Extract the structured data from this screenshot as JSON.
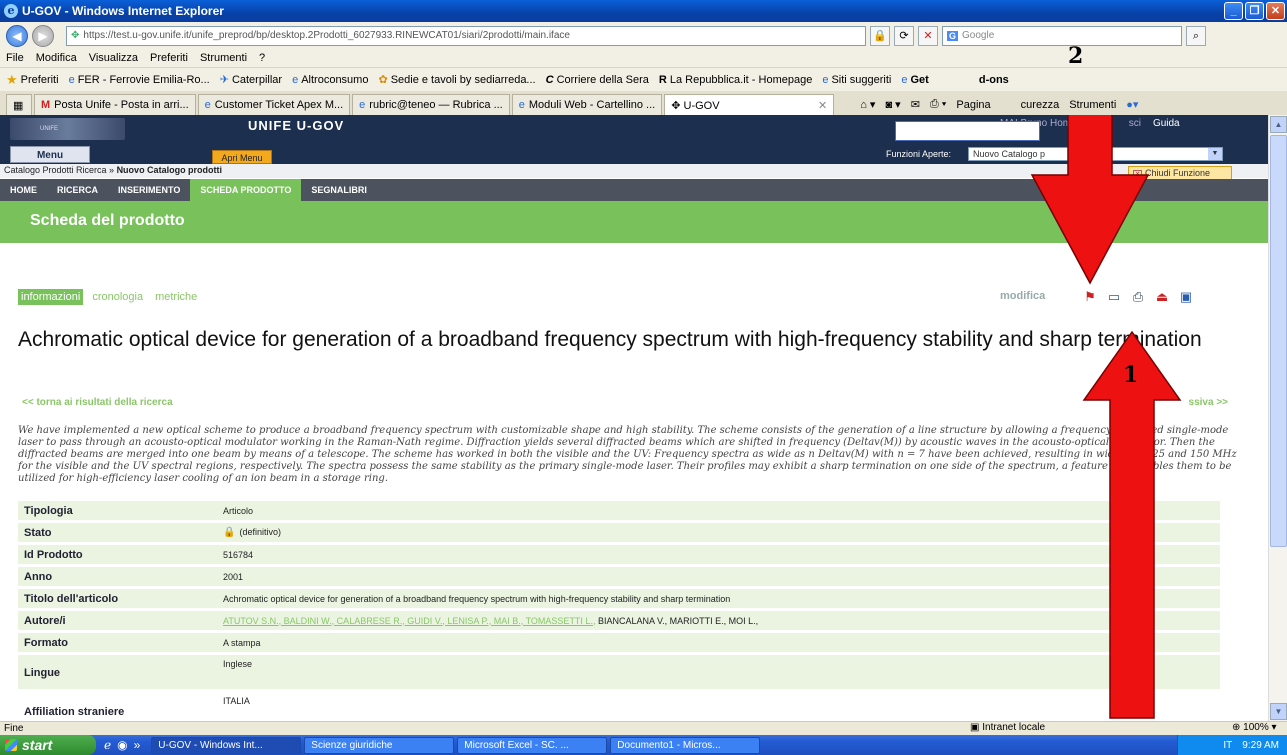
{
  "window": {
    "title": "U-GOV - Windows Internet Explorer",
    "controls": [
      "_",
      "❐",
      "✕"
    ]
  },
  "address": {
    "url": "https://test.u-gov.unife.it/unife_preprod/bp/desktop.2Prodotti_6027933.RINEWCAT01/siari/2prodotti/main.iface",
    "search_placeholder": "Google"
  },
  "menu": [
    "File",
    "Modifica",
    "Visualizza",
    "Preferiti",
    "Strumenti",
    "?"
  ],
  "favorites": {
    "label": "Preferiti",
    "items": [
      "FER - Ferrovie Emilia-Ro...",
      "Caterpillar",
      "Altroconsumo",
      "Sedie e tavoli by sediarreda...",
      "Corriere della Sera",
      "La Repubblica.it - Homepage",
      "Siti suggeriti",
      "Get",
      "d-ons"
    ]
  },
  "tabs": [
    "Posta Unife - Posta in arri...",
    "Customer Ticket Apex M...",
    "rubric@teneo — Rubrica ...",
    "Moduli Web - Cartellino ...",
    "U-GOV"
  ],
  "tab_tools": [
    "Pagina",
    "curezza",
    "Strumenti"
  ],
  "ugov": {
    "title": "UNIFE U-GOV",
    "logo_text": "UNIFE",
    "top_links": [
      "MAI Bruno Home",
      "sci",
      "Guida"
    ],
    "menu_btn": "Menu",
    "apri_menu": "Apri Menu",
    "funzioni_label": "Funzioni Aperte:",
    "funzioni_value": "Nuovo Catalogo p",
    "breadcrumb_prefix": "Catalogo Prodotti Ricerca » ",
    "breadcrumb_current": "Nuovo Catalogo prodotti",
    "chiudi": "Chiudi Funzione",
    "nav": [
      "HOME",
      "RICERCA",
      "INSERIMENTO",
      "SCHEDA PRODOTTO",
      "SEGNALIBRI"
    ],
    "section_title": "Scheda del prodotto",
    "subtabs": [
      "informazioni",
      "cronologia",
      "metriche"
    ],
    "modifica": "modifica",
    "product_title": "Achromatic optical device for generation of a broadband frequency spectrum with high-frequency stability and sharp termination",
    "back_link": "<< torna ai risultati della ricerca",
    "next_link": "ssiva >>",
    "abstract": "We have implemented a new optical scheme to produce a broadband frequency spectrum with customizable shape and high stability. The scheme consists of the generation of a line structure by allowing a frequency-stabilized single-mode laser to pass through an acousto-optical modulator working in the Raman-Nath regime. Diffraction yields several diffracted beams which are shifted in frequency (Deltav(M)) by acoustic waves in the acousto-optical modulator. Then the diffracted beams are merged into one beam by means of a telescope. The scheme has worked in both the visible and the UV: Frequency spectra as wide as n Deltav(M) with n = 7 have been achieved, resulting in widths of 225 and 150 MHz for the visible and the UV spectral regions, respectively. The spectra possess the same stability as the primary single-mode laser. Their profiles may exhibit a sharp termination on one side of the spectrum, a feature that enables them to be utilized for high-efficiency laser cooling of an ion beam in a storage ring.",
    "rows": [
      {
        "k": "Tipologia",
        "v": "Articolo"
      },
      {
        "k": "Stato",
        "v": "(definitivo)"
      },
      {
        "k": "Id Prodotto",
        "v": "516784"
      },
      {
        "k": "Anno",
        "v": "2001"
      },
      {
        "k": "Titolo dell'articolo",
        "v": "Achromatic optical device for generation of a broadband frequency spectrum with high-frequency stability and sharp termination"
      },
      {
        "k": "Autore/i",
        "v_linked": "ATUTOV S.N., BALDINI W., CALABRESE R., GUIDI V., LENISA P., MAI B., TOMASSETTI L.,",
        "v": " BIANCALANA V., MARIOTTI E., MOI L.,"
      },
      {
        "k": "Formato",
        "v": "A stampa"
      },
      {
        "k": "Lingue",
        "v": "Inglese"
      },
      {
        "k": "Affiliation straniere",
        "v": "ITALIA"
      }
    ]
  },
  "annotations": {
    "arrow1": "1",
    "arrow2": "2",
    "color": "#ee1111"
  },
  "status": {
    "left": "Fine",
    "zone": "Intranet locale",
    "zoom": "100%"
  },
  "taskbar": {
    "start": "start",
    "items": [
      "U-GOV - Windows Int...",
      "Scienze giuridiche",
      "Microsoft Excel - SC. ...",
      "Documento1 - Micros..."
    ],
    "lang": "IT",
    "clock": "9:29 AM"
  }
}
